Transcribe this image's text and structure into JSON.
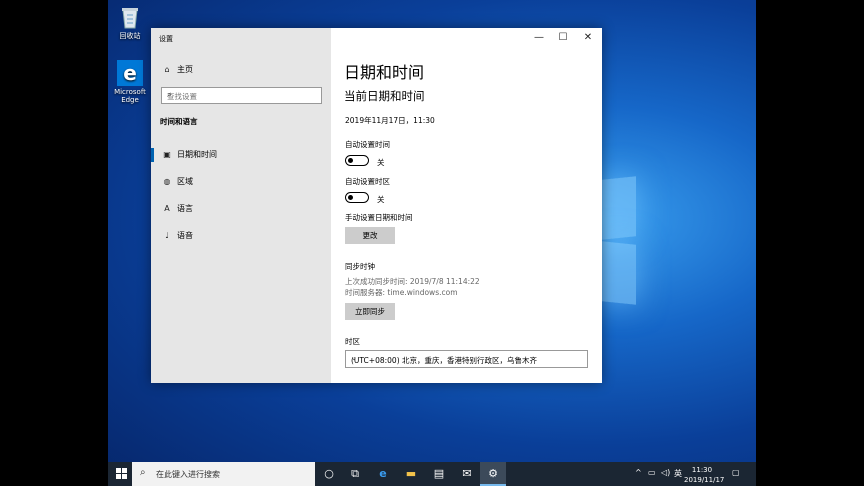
{
  "desktop": {
    "icons": [
      {
        "label": "回收站",
        "icon": "recycle-bin-icon"
      },
      {
        "label": "Microsoft Edge",
        "icon": "edge-icon"
      }
    ]
  },
  "window": {
    "title": "设置",
    "controls": {
      "minimize": "—",
      "maximize": "☐",
      "close": "✕"
    }
  },
  "sidebar": {
    "home_label": "主页",
    "search_placeholder": "查找设置",
    "section_title": "时间和语言",
    "items": [
      {
        "label": "日期和时间",
        "icon": "calendar-clock-icon",
        "selected": true
      },
      {
        "label": "区域",
        "icon": "globe-icon",
        "selected": false
      },
      {
        "label": "语言",
        "icon": "language-icon",
        "selected": false
      },
      {
        "label": "语音",
        "icon": "microphone-icon",
        "selected": false
      }
    ]
  },
  "main": {
    "page_title": "日期和时间",
    "current_heading": "当前日期和时间",
    "current_datetime": "2019年11月17日，11:30",
    "auto_time_label": "自动设置时间",
    "auto_time_state": "关",
    "auto_zone_label": "自动设置时区",
    "auto_zone_state": "关",
    "manual_label": "手动设置日期和时间",
    "change_button": "更改",
    "sync_heading": "同步时钟",
    "last_sync": "上次成功同步时间: 2019/7/8 11:14:22",
    "time_server": "时间服务器: time.windows.com",
    "sync_button": "立即同步",
    "timezone_label": "时区",
    "timezone_value": "(UTC+08:00) 北京，重庆，香港特别行政区，乌鲁木齐"
  },
  "taskbar": {
    "search_placeholder": "在此键入进行搜索",
    "ime": "英",
    "clock_time": "11:30",
    "clock_date": "2019/11/17"
  },
  "colors": {
    "accent": "#0063b1",
    "taskbar": "#1b2633"
  }
}
